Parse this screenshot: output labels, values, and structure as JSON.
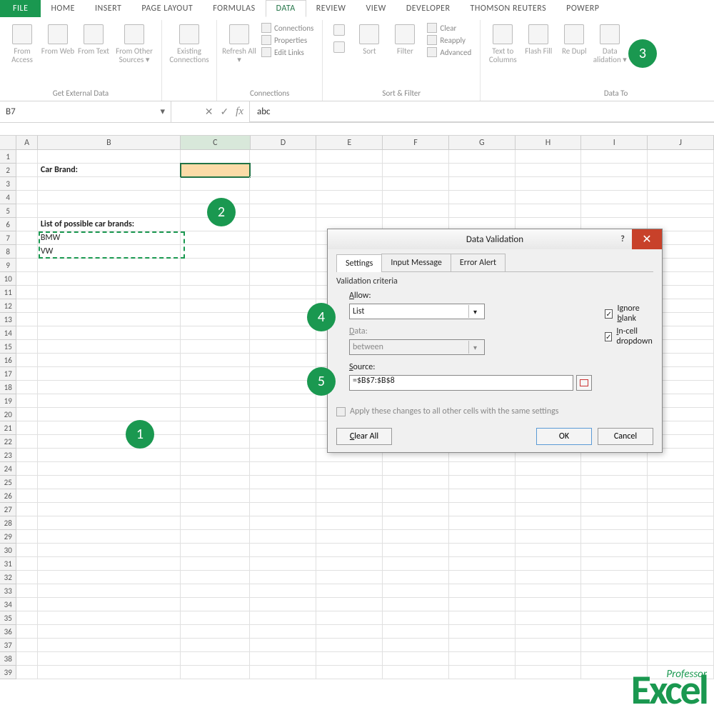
{
  "ribbonTabs": {
    "file": "FILE",
    "home": "HOME",
    "insert": "INSERT",
    "pageLayout": "PAGE LAYOUT",
    "formulas": "FORMULAS",
    "data": "DATA",
    "review": "REVIEW",
    "view": "VIEW",
    "developer": "DEVELOPER",
    "thomson": "THOMSON REUTERS",
    "powerp": "POWERP"
  },
  "ribbon": {
    "getExternal": {
      "label": "Get External Data",
      "access": "From Access",
      "web": "From Web",
      "text": "From Text",
      "other": "From Other Sources ▾"
    },
    "existing": "Existing Connections",
    "refresh": "Refresh All ▾",
    "connectionsGroup": {
      "label": "Connections",
      "connections": "Connections",
      "properties": "Properties",
      "editLinks": "Edit Links"
    },
    "sortFilter": {
      "label": "Sort & Filter",
      "sort": "Sort",
      "filter": "Filter",
      "clear": "Clear",
      "reapply": "Reapply",
      "advanced": "Advanced"
    },
    "dataTools": {
      "label": "Data To",
      "textToCols": "Text to Columns",
      "flashFill": "Flash Fill",
      "removeDup": "Re\nDupl",
      "validation": "Data\nalidation ▾"
    }
  },
  "nameBox": "B7",
  "formulaValue": "abc",
  "sheet": {
    "b2": "Car Brand:",
    "b6": "List of possible car brands:",
    "b7": "BMW",
    "b8": "VW",
    "cols": [
      "A",
      "B",
      "C",
      "D",
      "E",
      "F",
      "G",
      "H",
      "I",
      "J"
    ]
  },
  "badges": {
    "b1": "1",
    "b2": "2",
    "b3": "3",
    "b4": "4",
    "b5": "5"
  },
  "dialog": {
    "title": "Data Validation",
    "tabs": {
      "settings": "Settings",
      "input": "Input Message",
      "error": "Error Alert"
    },
    "section": "Validation criteria",
    "allowLabel": "Allow:",
    "allowValue": "List",
    "dataLabel": "Data:",
    "dataValue": "between",
    "ignoreBlank": "Ignore blank",
    "inCell": "In-cell dropdown",
    "sourceLabel": "Source:",
    "sourceValue": "=$B$7:$B$8",
    "applyAll": "Apply these changes to all other cells with the same settings",
    "clearAll": "Clear All",
    "ok": "OK",
    "cancel": "Cancel",
    "help": "?",
    "close": "✕"
  },
  "logo": {
    "small": "Professor",
    "big": "Excel"
  }
}
